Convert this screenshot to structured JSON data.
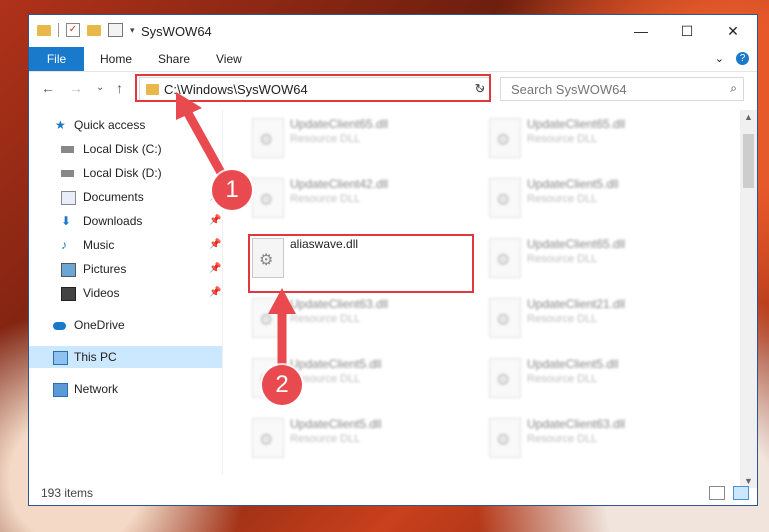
{
  "window": {
    "title": "SysWOW64",
    "minimize": "—",
    "maximize": "☐",
    "close": "✕"
  },
  "ribbon": {
    "file": "File",
    "home": "Home",
    "share": "Share",
    "view": "View",
    "expand": "⌄",
    "help": "?"
  },
  "nav": {
    "back": "←",
    "forward": "→",
    "recent": "⌄",
    "up": "↑"
  },
  "address": {
    "path": "C:\\Windows\\SysWOW64",
    "dropdown": "⌄",
    "refresh": "↻"
  },
  "search": {
    "placeholder": "Search SysWOW64",
    "icon": "⌕"
  },
  "sidebar": {
    "items": [
      {
        "label": "Quick access",
        "icon": "star-icon"
      },
      {
        "label": "Local Disk (C:)",
        "icon": "drive-icon"
      },
      {
        "label": "Local Disk (D:)",
        "icon": "drive-icon"
      },
      {
        "label": "Documents",
        "icon": "documents-icon",
        "pinned": true
      },
      {
        "label": "Downloads",
        "icon": "downloads-icon",
        "pinned": true
      },
      {
        "label": "Music",
        "icon": "music-icon",
        "pinned": true
      },
      {
        "label": "Pictures",
        "icon": "pictures-icon",
        "pinned": true
      },
      {
        "label": "Videos",
        "icon": "videos-icon",
        "pinned": true
      },
      {
        "label": "OneDrive",
        "icon": "cloud-icon"
      },
      {
        "label": "This PC",
        "icon": "computer-icon",
        "selected": true
      },
      {
        "label": "Network",
        "icon": "network-icon"
      }
    ]
  },
  "files": [
    {
      "name": "UpdateClient65.dll",
      "desc": "Resource DLL"
    },
    {
      "name": "UpdateClient65.dll",
      "desc": "Resource DLL"
    },
    {
      "name": "UpdateClient42.dll",
      "desc": "Resource DLL"
    },
    {
      "name": "UpdateClient5.dll",
      "desc": "Resource DLL"
    },
    {
      "name": "aliaswave.dll",
      "desc": ""
    },
    {
      "name": "UpdateClient65.dll",
      "desc": "Resource DLL"
    },
    {
      "name": "UpdateClient63.dll",
      "desc": "Resource DLL"
    },
    {
      "name": "UpdateClient21.dll",
      "desc": "Resource DLL"
    },
    {
      "name": "UpdateClient5.dll",
      "desc": "Resource DLL"
    },
    {
      "name": "UpdateClient5.dll",
      "desc": "Resource DLL"
    },
    {
      "name": "UpdateClient5.dll",
      "desc": "Resource DLL"
    },
    {
      "name": "UpdateClient63.dll",
      "desc": "Resource DLL"
    }
  ],
  "status": {
    "count": "193 items"
  },
  "markers": {
    "one": "1",
    "two": "2"
  },
  "colors": {
    "accent": "#1979ca",
    "highlight": "#e0383e",
    "selected": "#cce8ff"
  }
}
